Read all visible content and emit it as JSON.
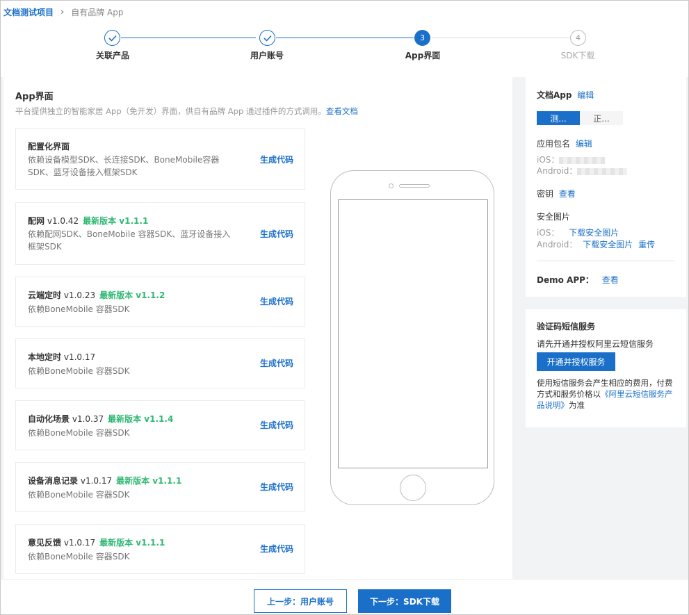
{
  "breadcrumb": {
    "project": "文档测试项目",
    "current": "自有品牌 App"
  },
  "steps": [
    {
      "label": "关联产品",
      "state": "done",
      "number": "1"
    },
    {
      "label": "用户账号",
      "state": "done",
      "number": "2"
    },
    {
      "label": "App界面",
      "state": "active",
      "number": "3"
    },
    {
      "label": "SDK下载",
      "state": "todo",
      "number": "4"
    }
  ],
  "main": {
    "title": "App界面",
    "desc": "平台提供独立的智能家居 App（免开发）界面，供自有品牌 App 通过插件的方式调用。",
    "doc_link": "查看文档",
    "cards": [
      {
        "title": "配置化界面",
        "version": "",
        "latest": "",
        "desc": "依赖设备模型SDK、长连接SDK、BoneMobile容器SDK、蓝牙设备接入框架SDK",
        "action": "生成代码"
      },
      {
        "title": "配网",
        "version": "v1.0.42",
        "latest": "最新版本 v1.1.1",
        "desc": "依赖配网SDK、BoneMobile 容器SDK、蓝牙设备接入框架SDK",
        "action": "生成代码"
      },
      {
        "title": "云端定时",
        "version": "v1.0.23",
        "latest": "最新版本 v1.1.2",
        "desc": "依赖BoneMobile 容器SDK",
        "action": "生成代码"
      },
      {
        "title": "本地定时",
        "version": "v1.0.17",
        "latest": "",
        "desc": "依赖BoneMobile 容器SDK",
        "action": "生成代码"
      },
      {
        "title": "自动化场景",
        "version": "v1.0.37",
        "latest": "最新版本 v1.1.4",
        "desc": "依赖BoneMobile 容器SDK",
        "action": "生成代码"
      },
      {
        "title": "设备消息记录",
        "version": "v1.0.17",
        "latest": "最新版本 v1.1.1",
        "desc": "依赖BoneMobile 容器SDK",
        "action": "生成代码"
      },
      {
        "title": "意见反馈",
        "version": "v1.0.17",
        "latest": "最新版本 v1.1.1",
        "desc": "依赖BoneMobile 容器SDK",
        "action": "生成代码"
      }
    ]
  },
  "side": {
    "doc_app": "文档App",
    "edit": "编辑",
    "seg_on": "测...",
    "seg_off": "正...",
    "pkg_label": "应用包名",
    "pkg_edit": "编辑",
    "ios_label": "iOS：",
    "android_label": "Android：",
    "key_label": "密钥",
    "key_view": "查看",
    "security_label": "安全图片",
    "sec_ios_label": "iOS：",
    "sec_ios_link": "下载安全图片",
    "sec_android_label": "Android：",
    "sec_android_link": "下载安全图片",
    "sec_android_reupload": "重传",
    "demo_label": "Demo APP：",
    "demo_view": "查看"
  },
  "sms": {
    "title": "验证码短信服务",
    "tip": "请先开通并授权阿里云短信服务",
    "button": "开通并授权服务",
    "note_prefix": "使用短信服务会产生相应的费用，付费方式和服务价格以",
    "note_link": "《阿里云短信服务产品说明》",
    "note_suffix": "为准"
  },
  "footer": {
    "prev": "上一步：用户账号",
    "next": "下一步：SDK下载"
  },
  "colors": {
    "primary": "#1a6fc9",
    "latest": "#2eb872"
  }
}
